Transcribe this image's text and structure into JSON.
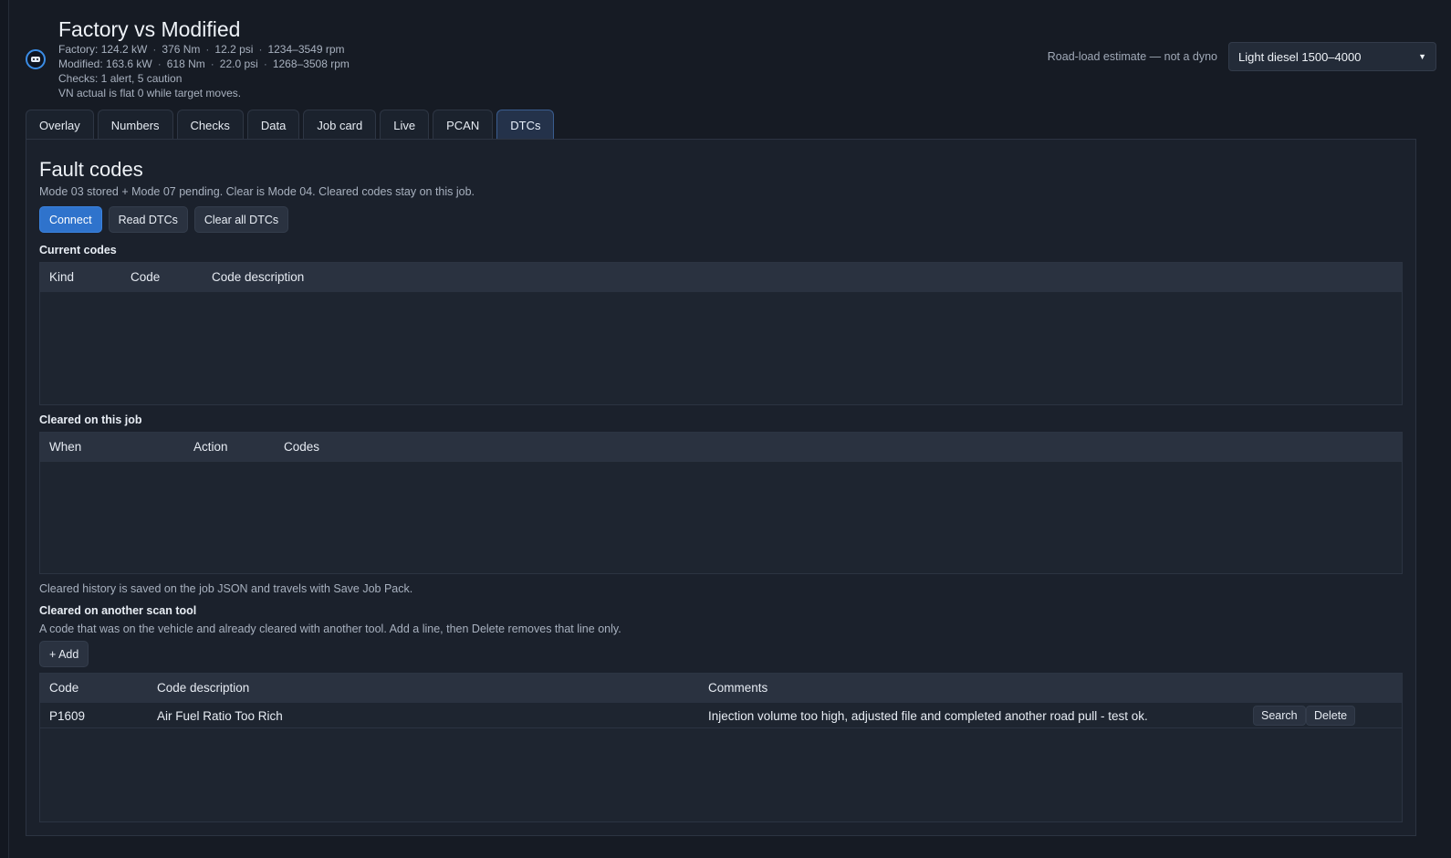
{
  "header": {
    "title": "Factory vs Modified",
    "factory": {
      "label": "Factory:",
      "power": "124.2 kW",
      "torque": "376 Nm",
      "boost": "12.2 psi",
      "rpm": "1234–3549 rpm"
    },
    "modified": {
      "label": "Modified:",
      "power": "163.6 kW",
      "torque": "618 Nm",
      "boost": "22.0 psi",
      "rpm": "1268–3508 rpm"
    },
    "checks": "Checks: 1 alert, 5 caution",
    "vn_note": "VN actual is flat 0 while target moves.",
    "estimate_note": "Road-load estimate — not a dyno",
    "profile_select": "Light diesel 1500–4000",
    "sep": "·"
  },
  "tabs": [
    {
      "label": "Overlay",
      "active": false
    },
    {
      "label": "Numbers",
      "active": false
    },
    {
      "label": "Checks",
      "active": false
    },
    {
      "label": "Data",
      "active": false
    },
    {
      "label": "Job card",
      "active": false
    },
    {
      "label": "Live",
      "active": false
    },
    {
      "label": "PCAN",
      "active": false
    },
    {
      "label": "DTCs",
      "active": true
    }
  ],
  "dtcs": {
    "title": "Fault codes",
    "description": "Mode 03 stored + Mode 07 pending. Clear is Mode 04. Cleared codes stay on this job.",
    "buttons": {
      "connect": "Connect",
      "read": "Read DTCs",
      "clear_all": "Clear all DTCs"
    },
    "current": {
      "label": "Current codes",
      "columns": [
        "Kind",
        "Code",
        "Code description"
      ],
      "rows": []
    },
    "cleared": {
      "label": "Cleared on this job",
      "columns": [
        "When",
        "Action",
        "Codes"
      ],
      "rows": [],
      "note": "Cleared history is saved on the job JSON and travels with Save Job Pack."
    },
    "external": {
      "label": "Cleared on another scan tool",
      "description": "A code that was on the vehicle and already cleared with another tool. Add a line, then Delete removes that line only.",
      "add_button": "+ Add",
      "columns": [
        "Code",
        "Code description",
        "Comments"
      ],
      "rows": [
        {
          "code": "P1609",
          "description": "Air Fuel Ratio Too Rich",
          "comments": "Injection volume too high, adjusted file and completed another road pull - test ok.",
          "search": "Search",
          "delete": "Delete"
        }
      ]
    }
  },
  "colors": {
    "accent": "#2f73cc",
    "background": "#161b24",
    "panel": "#1b212c"
  }
}
